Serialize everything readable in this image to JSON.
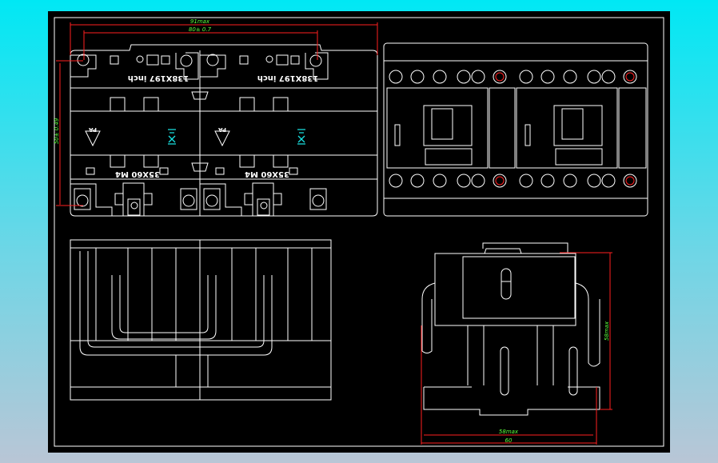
{
  "drawing": {
    "top_left_view": {
      "dim_overall_width": "91max",
      "dim_mount_width": "80± 0.7",
      "dim_mount_height": "50± 0.49",
      "label_size_left": "138X197 inch",
      "label_size_right": "138X197 inch",
      "label_screw_left": "35X60  M4",
      "label_screw_right": "35X60  M4",
      "material_left": "PA",
      "material_right": "PA"
    },
    "bottom_right_view": {
      "dim_height": "58max",
      "dim_body_width": "58max",
      "dim_total_width": "60"
    }
  },
  "colors": {
    "background": "#000000",
    "lines": "#ffffff",
    "dimension": "#ff2020",
    "dimension_text": "#5cff3c",
    "symbol": "#19e0e0"
  }
}
